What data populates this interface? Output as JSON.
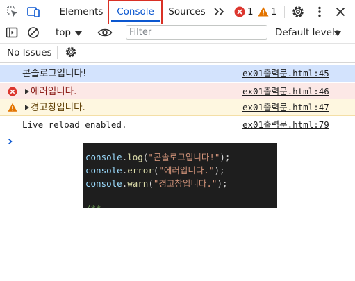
{
  "tabs": [
    {
      "label": "Elements"
    },
    {
      "label": "Console"
    },
    {
      "label": "Sources"
    }
  ],
  "badges": {
    "errors": "1",
    "warnings": "1"
  },
  "toolbar": {
    "context": "top",
    "filter_placeholder": "Filter",
    "levels": "Default levels"
  },
  "issues": {
    "label": "No Issues"
  },
  "messages": [
    {
      "type": "log",
      "text": "콘솔로그입니다!",
      "source": "ex01출력문.html:45"
    },
    {
      "type": "error",
      "text": "에러입니다.",
      "source": "ex01출력문.html:46"
    },
    {
      "type": "warning",
      "text": "경고창입니다.",
      "source": "ex01출력문.html:47"
    },
    {
      "type": "info",
      "text": "Live reload enabled.",
      "source": "ex01출력문.html:79"
    }
  ],
  "code": {
    "lines": [
      {
        "obj": "console",
        "fn": "log",
        "str": "\"콘솔로그입니다!\""
      },
      {
        "obj": "console",
        "fn": "error",
        "str": "\"에러입니다.\""
      },
      {
        "obj": "console",
        "fn": "warn",
        "str": "\"경고창입니다.\""
      }
    ],
    "trailing": "/**"
  },
  "colors": {
    "accent": "#0b57d0",
    "highlight": "#d93025",
    "log_bg": "#d3e3fd",
    "error_bg": "#fce8e6",
    "warning_bg": "#fef7e0",
    "error_icon": "#dc362e",
    "warning_icon": "#e37400"
  }
}
